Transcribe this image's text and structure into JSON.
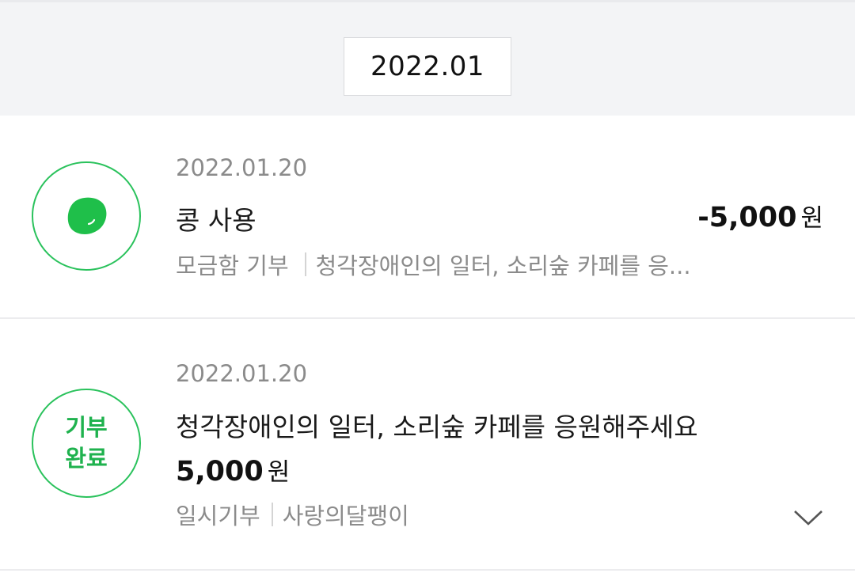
{
  "month_filter": {
    "label": "2022.01"
  },
  "transactions": [
    {
      "date": "2022.01.20",
      "title": "콩 사용",
      "amount": "-5,000",
      "unit": "원",
      "category": "모금함 기부",
      "description": "청각장애인의 일터, 소리숲 카페를 응...",
      "icon": "bean-icon",
      "accent_color": "#2ac25c"
    },
    {
      "date": "2022.01.20",
      "title": "청각장애인의 일터, 소리숲 카페를 응원해주세요",
      "amount": "5,000",
      "unit": "원",
      "badge_line1": "기부",
      "badge_line2": "완료",
      "category": "일시기부",
      "organization": "사랑의달팽이",
      "expand_icon": "chevron-down-icon",
      "accent_color": "#1fb24e"
    }
  ]
}
